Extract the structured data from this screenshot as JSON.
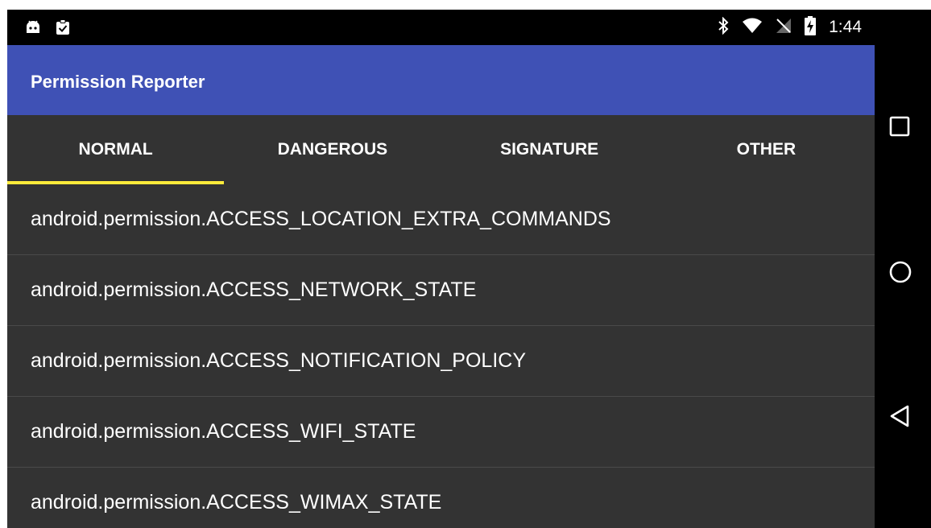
{
  "status_bar": {
    "time": "1:44",
    "left_icons": [
      "android-debug-icon",
      "clipboard-check-icon"
    ],
    "right_icons": [
      "bluetooth-icon",
      "wifi-icon",
      "no-signal-icon",
      "battery-charging-icon"
    ]
  },
  "app_bar": {
    "title": "Permission Reporter",
    "color": "#3f51b5"
  },
  "tabs": [
    {
      "label": "NORMAL",
      "selected": true
    },
    {
      "label": "DANGEROUS",
      "selected": false
    },
    {
      "label": "SIGNATURE",
      "selected": false
    },
    {
      "label": "OTHER",
      "selected": false
    }
  ],
  "tab_indicator_color": "#ffeb3b",
  "permissions": [
    "android.permission.ACCESS_LOCATION_EXTRA_COMMANDS",
    "android.permission.ACCESS_NETWORK_STATE",
    "android.permission.ACCESS_NOTIFICATION_POLICY",
    "android.permission.ACCESS_WIFI_STATE",
    "android.permission.ACCESS_WIMAX_STATE"
  ],
  "nav_bar": {
    "buttons": [
      "recents-icon",
      "home-icon",
      "back-icon"
    ]
  }
}
